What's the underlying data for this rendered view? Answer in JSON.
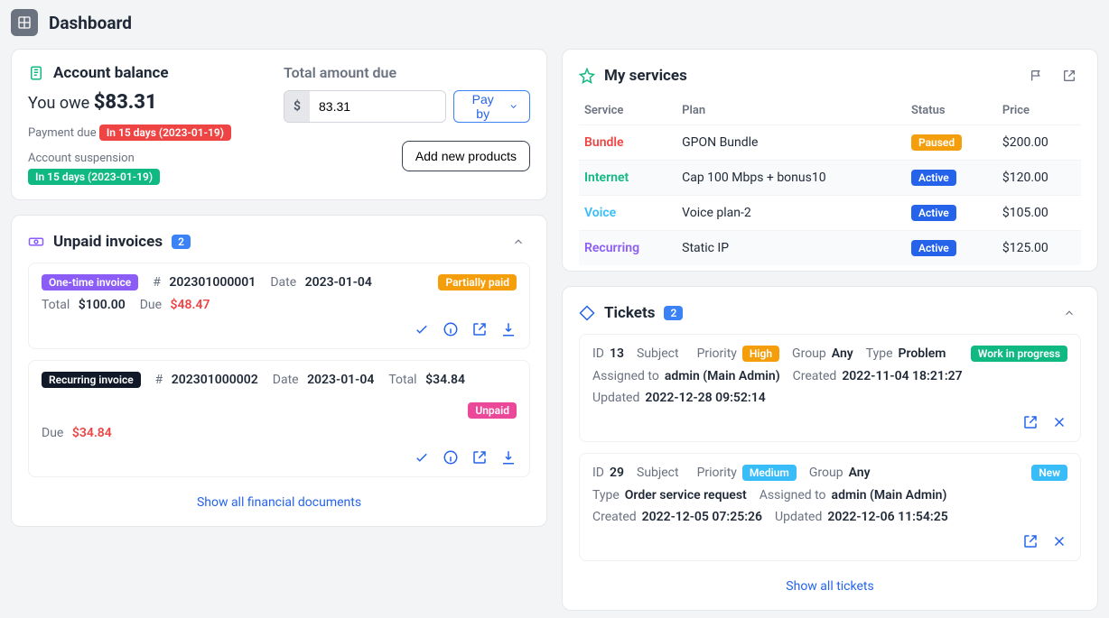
{
  "page": {
    "title": "Dashboard"
  },
  "balance": {
    "title": "Account balance",
    "owe_label": "You owe",
    "owe_amount": "$83.31",
    "payment_due_label": "Payment due",
    "payment_due_badge": "In 15 days (2023-01-19)",
    "suspension_label": "Account suspension",
    "suspension_badge": "In 15 days (2023-01-19)",
    "total_due_label": "Total amount due",
    "currency_prefix": "$",
    "amount_value": "83.31",
    "payby_label": "Pay by",
    "add_products_label": "Add new products"
  },
  "services": {
    "title": "My services",
    "col_service": "Service",
    "col_plan": "Plan",
    "col_status": "Status",
    "col_price": "Price",
    "rows": [
      {
        "service": "Bundle",
        "plan": "GPON Bundle",
        "status": "Paused",
        "status_class": "badge-orange",
        "price": "$200.00",
        "svc_class": "svc-bundle"
      },
      {
        "service": "Internet",
        "plan": "Cap 100 Mbps + bonus10",
        "status": "Active",
        "status_class": "badge-blue",
        "price": "$120.00",
        "svc_class": "svc-internet"
      },
      {
        "service": "Voice",
        "plan": "Voice plan-2",
        "status": "Active",
        "status_class": "badge-blue",
        "price": "$105.00",
        "svc_class": "svc-voice"
      },
      {
        "service": "Recurring",
        "plan": "Static IP",
        "status": "Active",
        "status_class": "badge-blue",
        "price": "$125.00",
        "svc_class": "svc-recurring"
      }
    ]
  },
  "invoices": {
    "title": "Unpaid invoices",
    "count": "2",
    "show_all": "Show all financial documents",
    "labels": {
      "num": "#",
      "date": "Date",
      "total": "Total",
      "due": "Due"
    },
    "items": [
      {
        "type_label": "One-time invoice",
        "type_class": "badge-purple",
        "number": "202301000001",
        "date": "2023-01-04",
        "total": "$100.00",
        "due": "$48.47",
        "status": "Partially paid",
        "status_class": "badge-orange"
      },
      {
        "type_label": "Recurring invoice",
        "type_class": "badge-dark",
        "number": "202301000002",
        "date": "2023-01-04",
        "total": "$34.84",
        "due": "$34.84",
        "status": "Unpaid",
        "status_class": "badge-pink"
      }
    ]
  },
  "tickets": {
    "title": "Tickets",
    "count": "2",
    "show_all": "Show all tickets",
    "labels": {
      "id": "ID",
      "subject": "Subject",
      "priority": "Priority",
      "group": "Group",
      "type": "Type",
      "assigned": "Assigned to",
      "created": "Created",
      "updated": "Updated"
    },
    "items": [
      {
        "id": "13",
        "subject": "",
        "priority": "High",
        "priority_class": "badge-orange",
        "group": "Any",
        "type": "Problem",
        "assigned": "admin (Main Admin)",
        "created": "2022-11-04 18:21:27",
        "updated": "2022-12-28 09:52:14",
        "status": "Work in progress",
        "status_class": "badge-green"
      },
      {
        "id": "29",
        "subject": "",
        "priority": "Medium",
        "priority_class": "badge-sky",
        "group": "Any",
        "type": "Order service request",
        "assigned": "admin (Main Admin)",
        "created": "2022-12-05 07:25:26",
        "updated": "2022-12-06 11:54:25",
        "status": "New",
        "status_class": "badge-sky"
      }
    ]
  }
}
